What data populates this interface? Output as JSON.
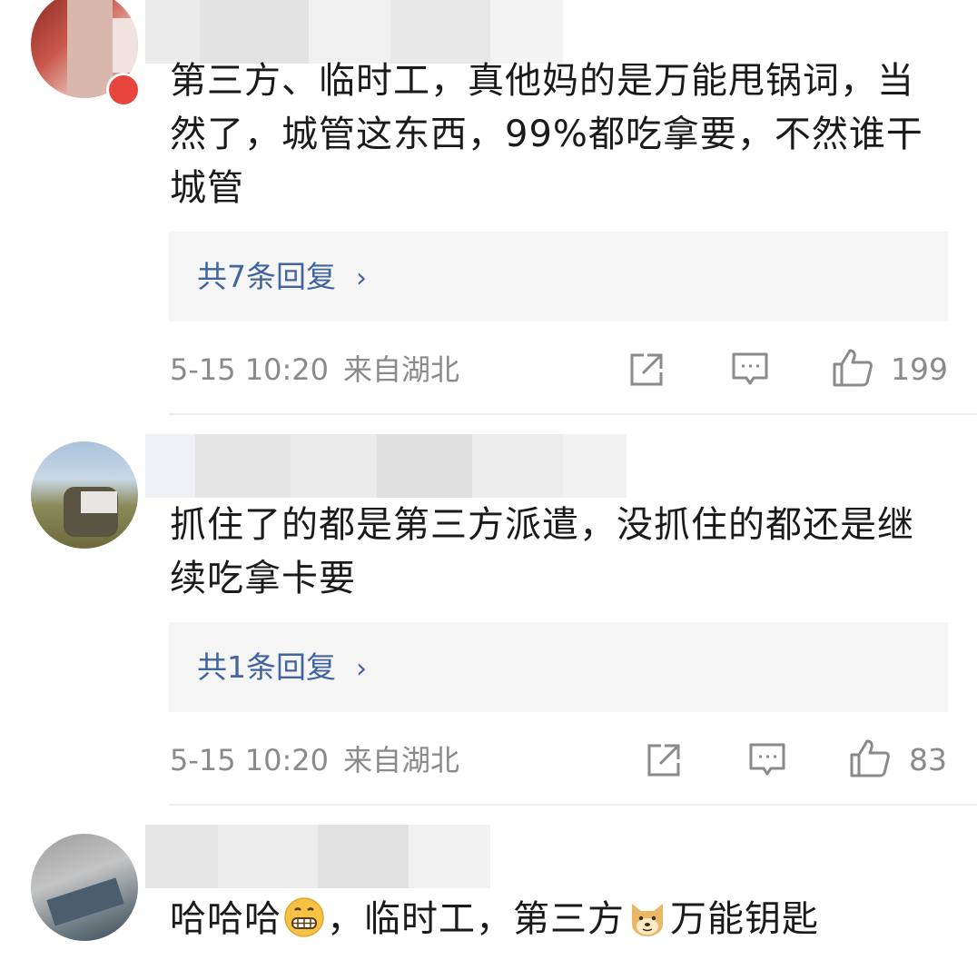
{
  "comments": [
    {
      "text": "第三方、临时工，真他妈的是万能甩锅词，当然了，城管这东西，99%都吃拿要，不然谁干城管",
      "reply_link": "共7条回复",
      "time": "5-15 10:20",
      "location": "来自湖北",
      "likes": "199"
    },
    {
      "text": "抓住了的都是第三方派遣，没抓住的都还是继续吃拿卡要",
      "reply_link": "共1条回复",
      "time": "5-15 10:20",
      "location": "来自湖北",
      "likes": "83"
    },
    {
      "text_part1": "哈哈哈",
      "text_part2": "，临时工，第三方",
      "text_part3": "万能钥匙"
    }
  ],
  "icons": [
    "share-icon",
    "comment-icon",
    "like-icon",
    "grin-emoji",
    "doge-emoji",
    "chevron-right-icon"
  ],
  "colors": {
    "link": "#41649c",
    "meta": "#8a8a8a",
    "reply_bg": "#f5f5f5"
  }
}
